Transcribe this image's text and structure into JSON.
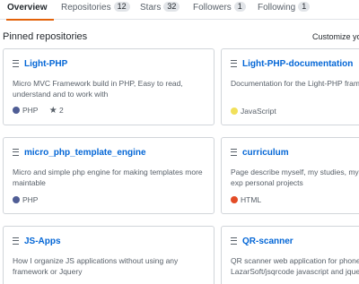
{
  "tabs": [
    {
      "label": "Overview",
      "count": ""
    },
    {
      "label": "Repositories",
      "count": "12"
    },
    {
      "label": "Stars",
      "count": "32"
    },
    {
      "label": "Followers",
      "count": "1"
    },
    {
      "label": "Following",
      "count": "1"
    }
  ],
  "section": {
    "title": "Pinned repositories",
    "customize_label": "Customize yo"
  },
  "repos": [
    {
      "name": "Light-PHP",
      "description": "Micro MVC Framework build in PHP, Easy to read, understand and to work with",
      "language": "PHP",
      "language_color": "#4F5D95",
      "stars": "2"
    },
    {
      "name": "Light-PHP-documentation",
      "description": "Documentation for the Light-PHP framew",
      "language": "JavaScript",
      "language_color": "#f1e05a",
      "stars": ""
    },
    {
      "name": "micro_php_template_engine",
      "description": "Micro and simple php engine for making templates more maintable",
      "language": "PHP",
      "language_color": "#4F5D95",
      "stars": ""
    },
    {
      "name": "curriculum",
      "description": "Page describe myself, my studies, my exp personal projects",
      "language": "HTML",
      "language_color": "#e34c26",
      "stars": ""
    },
    {
      "name": "JS-Apps",
      "description": "How I organize JS applications without using any framework or Jquery",
      "language": "",
      "language_color": "",
      "stars": ""
    },
    {
      "name": "QR-scanner",
      "description": "QR scanner web application for phone, u LazarSoft/jsqrcode javascript and jquery t",
      "language": "",
      "language_color": "",
      "stars": ""
    }
  ]
}
